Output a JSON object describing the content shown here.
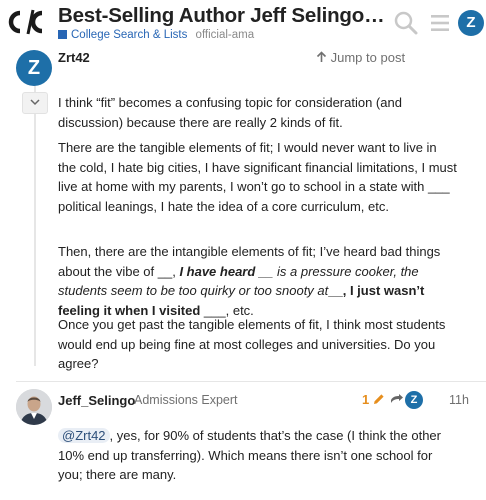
{
  "header": {
    "logo_text": "C/C",
    "title": "Best-Selling Author Jeff Selingo R...",
    "category": "College Search & Lists",
    "tag": "official-ama",
    "user_avatar_letter": "Z"
  },
  "posts": [
    {
      "avatar_letter": "Z",
      "username": "Zrt42",
      "jump_label": "Jump to post",
      "paragraphs": [
        "I think “fit” becomes a confusing topic for consideration (and discussion) because there are really 2 kinds of fit.",
        "There are the tangible elements of fit; I would never want to live in the cold, I hate big cities, I have significant financial limitations, I must live at home with my parents, I won’t go to school in a state with ___ political leanings, I hate the idea of a core curriculum, etc.",
        "Once you get past the tangible elements of fit, I think most students would end up being fine at most colleges and universities. Do you agree?"
      ],
      "p3": {
        "pre": "Then, there are the intangible elements of fit; I’ve heard bad things about the vibe of __, ",
        "bold_italic_1": "I have heard",
        "italic_1": "__ is a pressure cooker, the students seem to be too quirky or too snooty at",
        "bold_1": "__, I just wasn’t feeling it when I visited",
        "post": " ___, etc."
      }
    },
    {
      "username": "Jeff_Selingo",
      "user_title": "Admissions Expert",
      "edit_count": "1",
      "reply_to_letter": "Z",
      "time": "11h",
      "mention": "@Zrt42",
      "text": ", yes, for 90% of students that’s the case (I think the other 10% end up transferring). Which means there isn’t one school for you; there are many."
    }
  ],
  "colors": {
    "accent": "#1e6fa8",
    "category": "#2866b5",
    "edit": "#e68e1d"
  },
  "icons": [
    "cc-logo",
    "search-icon",
    "hamburger-menu-icon",
    "arrow-up-icon",
    "chevron-down-icon",
    "pencil-icon",
    "reply-arrow-icon"
  ]
}
